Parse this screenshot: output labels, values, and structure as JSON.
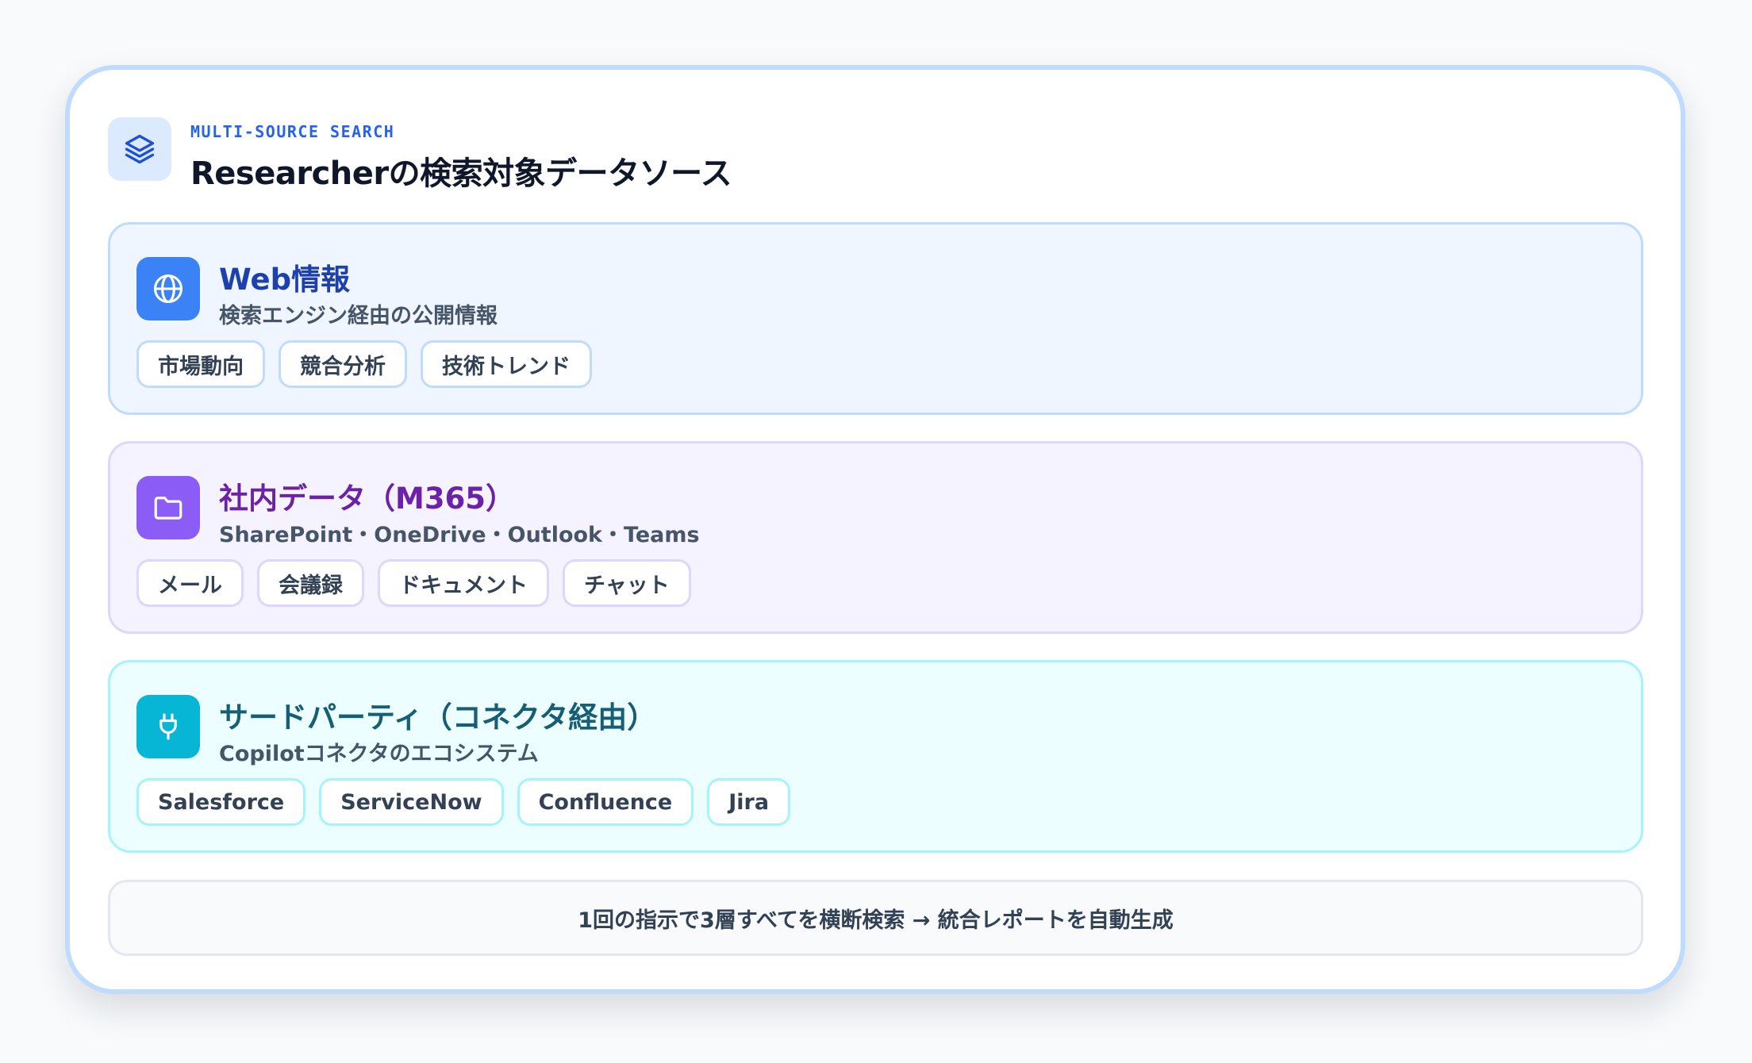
{
  "header": {
    "icon": "layers-icon",
    "eyebrow": "MULTI-SOURCE SEARCH",
    "title": "Researcherの検索対象データソース"
  },
  "sources": [
    {
      "id": "web",
      "icon": "globe-icon",
      "title": "Web情報",
      "subtitle": "検索エンジン経由の公開情報",
      "accent": "#3b82f6",
      "tags": [
        "市場動向",
        "競合分析",
        "技術トレンド"
      ]
    },
    {
      "id": "m365",
      "icon": "folder-icon",
      "title": "社内データ（M365）",
      "subtitle": "SharePoint・OneDrive・Outlook・Teams",
      "accent": "#8b5cf6",
      "tags": [
        "メール",
        "会議録",
        "ドキュメント",
        "チャット"
      ]
    },
    {
      "id": "third",
      "icon": "plug-icon",
      "title": "サードパーティ（コネクタ経由）",
      "subtitle": "Copilotコネクタのエコシステム",
      "accent": "#06b6d4",
      "tags": [
        "Salesforce",
        "ServiceNow",
        "Confluence",
        "Jira"
      ]
    }
  ],
  "footer": {
    "text": "1回の指示で3層すべてを横断検索 → 統合レポートを自動生成"
  }
}
